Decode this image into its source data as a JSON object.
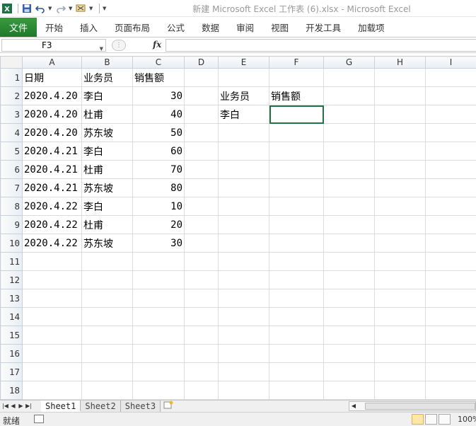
{
  "window": {
    "title": "新建 Microsoft Excel 工作表 (6).xlsx  -  Microsoft Excel"
  },
  "quick_access": [
    "excel-logo-icon",
    "save-icon",
    "undo-icon",
    "redo-icon",
    "tools-icon",
    "customize-icon"
  ],
  "ribbon": {
    "file_tab": "文件",
    "tabs": [
      "开始",
      "插入",
      "页面布局",
      "公式",
      "数据",
      "审阅",
      "视图",
      "开发工具",
      "加载项"
    ]
  },
  "formula_bar": {
    "name_box": "F3",
    "fx_label": "fx",
    "formula": ""
  },
  "grid": {
    "columns": [
      "A",
      "B",
      "C",
      "D",
      "E",
      "F",
      "G",
      "H",
      "I"
    ],
    "rows": [
      {
        "n": "1",
        "cells": [
          "日期",
          "业务员",
          "销售额",
          "",
          "",
          "",
          "",
          "",
          ""
        ]
      },
      {
        "n": "2",
        "cells": [
          "2020.4.20",
          "李白",
          "30",
          "",
          "业务员",
          "销售额",
          "",
          "",
          ""
        ]
      },
      {
        "n": "3",
        "cells": [
          "2020.4.20",
          "杜甫",
          "40",
          "",
          "李白",
          "",
          "",
          "",
          ""
        ]
      },
      {
        "n": "4",
        "cells": [
          "2020.4.20",
          "苏东坡",
          "50",
          "",
          "",
          "",
          "",
          "",
          ""
        ]
      },
      {
        "n": "5",
        "cells": [
          "2020.4.21",
          "李白",
          "60",
          "",
          "",
          "",
          "",
          "",
          ""
        ]
      },
      {
        "n": "6",
        "cells": [
          "2020.4.21",
          "杜甫",
          "70",
          "",
          "",
          "",
          "",
          "",
          ""
        ]
      },
      {
        "n": "7",
        "cells": [
          "2020.4.21",
          "苏东坡",
          "80",
          "",
          "",
          "",
          "",
          "",
          ""
        ]
      },
      {
        "n": "8",
        "cells": [
          "2020.4.22",
          "李白",
          "10",
          "",
          "",
          "",
          "",
          "",
          ""
        ]
      },
      {
        "n": "9",
        "cells": [
          "2020.4.22",
          "杜甫",
          "20",
          "",
          "",
          "",
          "",
          "",
          ""
        ]
      },
      {
        "n": "10",
        "cells": [
          "2020.4.22",
          "苏东坡",
          "30",
          "",
          "",
          "",
          "",
          "",
          ""
        ]
      },
      {
        "n": "11",
        "cells": [
          "",
          "",
          "",
          "",
          "",
          "",
          "",
          "",
          ""
        ]
      },
      {
        "n": "12",
        "cells": [
          "",
          "",
          "",
          "",
          "",
          "",
          "",
          "",
          ""
        ]
      },
      {
        "n": "13",
        "cells": [
          "",
          "",
          "",
          "",
          "",
          "",
          "",
          "",
          ""
        ]
      },
      {
        "n": "14",
        "cells": [
          "",
          "",
          "",
          "",
          "",
          "",
          "",
          "",
          ""
        ]
      },
      {
        "n": "15",
        "cells": [
          "",
          "",
          "",
          "",
          "",
          "",
          "",
          "",
          ""
        ]
      },
      {
        "n": "16",
        "cells": [
          "",
          "",
          "",
          "",
          "",
          "",
          "",
          "",
          ""
        ]
      },
      {
        "n": "17",
        "cells": [
          "",
          "",
          "",
          "",
          "",
          "",
          "",
          "",
          ""
        ]
      },
      {
        "n": "18",
        "cells": [
          "",
          "",
          "",
          "",
          "",
          "",
          "",
          "",
          ""
        ]
      }
    ]
  },
  "sheets": {
    "tabs": [
      "Sheet1",
      "Sheet2",
      "Sheet3"
    ],
    "active": "Sheet1"
  },
  "status": {
    "text": "就绪",
    "zoom": "100%"
  },
  "colors": {
    "file_tab": "#2e7d32",
    "selection": "#217346"
  }
}
